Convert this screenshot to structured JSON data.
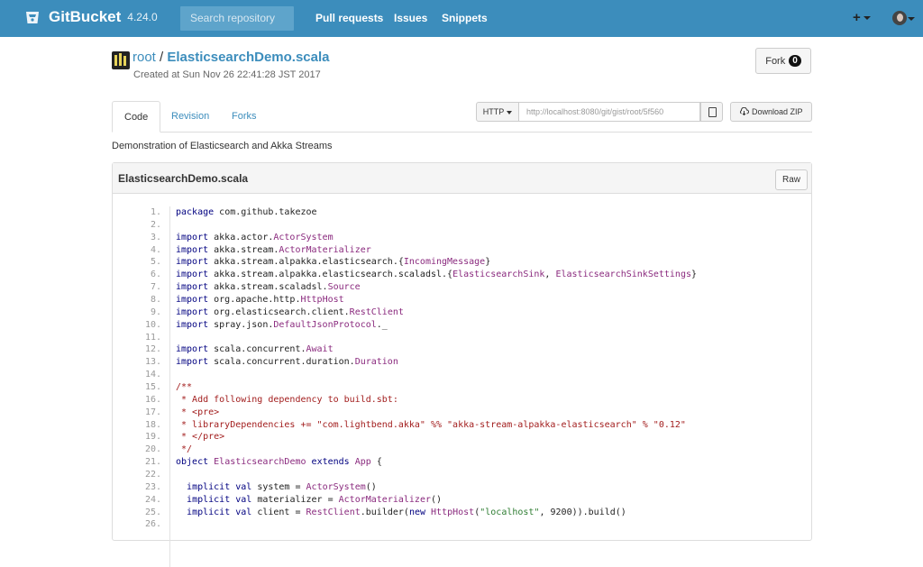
{
  "header": {
    "brand_name": "GitBucket",
    "brand_version": "4.24.0",
    "search_placeholder": "Search repository",
    "nav": [
      "Pull requests",
      "Issues",
      "Snippets"
    ],
    "plus_label": "+"
  },
  "repo": {
    "owner": "root",
    "separator": " / ",
    "name": "ElasticsearchDemo.scala",
    "created": "Created at Sun Nov 26 22:41:28 JST 2017",
    "fork_label": "Fork",
    "fork_count": "0"
  },
  "tabs": [
    "Code",
    "Revision",
    "Forks"
  ],
  "clone": {
    "protocol": "HTTP",
    "url": "http://localhost:8080/git/gist/root/5f560",
    "download_label": "Download ZIP"
  },
  "description": "Demonstration of Elasticsearch and Akka Streams",
  "file": {
    "name": "ElasticsearchDemo.scala",
    "raw_label": "Raw",
    "lines": [
      {
        "n": "1.",
        "code": "package com.github.takezoe"
      },
      {
        "n": "2.",
        "code": ""
      },
      {
        "n": "3.",
        "code": "import akka.actor.ActorSystem"
      },
      {
        "n": "4.",
        "code": "import akka.stream.ActorMaterializer"
      },
      {
        "n": "5.",
        "code": "import akka.stream.alpakka.elasticsearch.{IncomingMessage}"
      },
      {
        "n": "6.",
        "code": "import akka.stream.alpakka.elasticsearch.scaladsl.{ElasticsearchSink, ElasticsearchSinkSettings}"
      },
      {
        "n": "7.",
        "code": "import akka.stream.scaladsl.Source"
      },
      {
        "n": "8.",
        "code": "import org.apache.http.HttpHost"
      },
      {
        "n": "9.",
        "code": "import org.elasticsearch.client.RestClient"
      },
      {
        "n": "10.",
        "code": "import spray.json.DefaultJsonProtocol._"
      },
      {
        "n": "11.",
        "code": ""
      },
      {
        "n": "12.",
        "code": "import scala.concurrent.Await"
      },
      {
        "n": "13.",
        "code": "import scala.concurrent.duration.Duration"
      },
      {
        "n": "14.",
        "code": ""
      },
      {
        "n": "15.",
        "code": "/**"
      },
      {
        "n": "16.",
        "code": " * Add following dependency to build.sbt:"
      },
      {
        "n": "17.",
        "code": " * <pre>"
      },
      {
        "n": "18.",
        "code": " * libraryDependencies += \"com.lightbend.akka\" %% \"akka-stream-alpakka-elasticsearch\" % \"0.12\""
      },
      {
        "n": "19.",
        "code": " * </pre>"
      },
      {
        "n": "20.",
        "code": " */"
      },
      {
        "n": "21.",
        "code": "object ElasticsearchDemo extends App {"
      },
      {
        "n": "22.",
        "code": ""
      },
      {
        "n": "23.",
        "code": "  implicit val system = ActorSystem()"
      },
      {
        "n": "24.",
        "code": "  implicit val materializer = ActorMaterializer()"
      },
      {
        "n": "25.",
        "code": "  implicit val client = RestClient.builder(new HttpHost(\"localhost\", 9200)).build()"
      },
      {
        "n": "26.",
        "code": ""
      }
    ]
  }
}
